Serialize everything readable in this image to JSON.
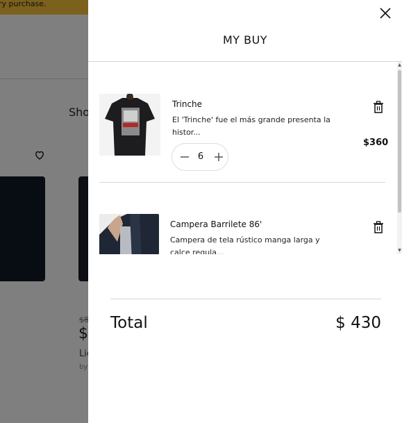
{
  "background": {
    "promo_text": "ry purchase.",
    "section_heading": "Sho",
    "product": {
      "old_price": "$8",
      "price": "$",
      "name": "Lic",
      "brand": "by"
    }
  },
  "cart": {
    "title": "MY BUY",
    "items": [
      {
        "name": "Trinche",
        "description": "El 'Trinche' fue el más grande presenta la histor...",
        "price": "$360",
        "quantity": "6"
      },
      {
        "name": "Campera Barrilete 86'",
        "description": "Campera de tela rústico manga larga y calce regula...",
        "price": ""
      }
    ],
    "total_label": "Total",
    "total_value": "$ 430"
  },
  "icons": {
    "close": "close-icon",
    "trash": "trash-icon",
    "minus": "minus-icon",
    "plus": "plus-icon",
    "heart": "heart-icon"
  },
  "colors": {
    "promo_bar": "#f7c23b",
    "overlay": "rgba(0,0,0,0.5)"
  }
}
